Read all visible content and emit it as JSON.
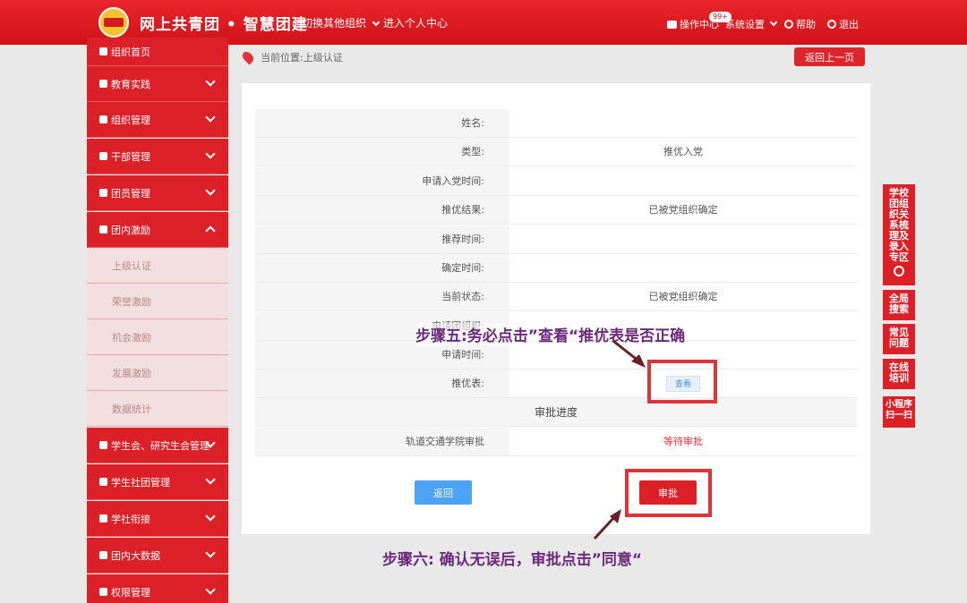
{
  "header": {
    "brand": "网上共青团 • 智慧团建",
    "switch_org": "切换其他组织",
    "personal_center": "进入个人中心",
    "ops_center": "操作中心",
    "ops_badge": "99+",
    "system_settings": "系统设置",
    "help": "帮助",
    "logout": "退出"
  },
  "sidebar": {
    "items": [
      {
        "label": "组织首页"
      },
      {
        "label": "教育实践"
      },
      {
        "label": "组织管理"
      },
      {
        "label": "干部管理"
      },
      {
        "label": "团员管理"
      },
      {
        "label": "团内激励"
      }
    ],
    "sub_items": [
      {
        "label": "上级认证"
      },
      {
        "label": "荣誉激励"
      },
      {
        "label": "机会激励"
      },
      {
        "label": "发展激励"
      },
      {
        "label": "数据统计"
      }
    ],
    "items_after": [
      {
        "label": "学生会、研究生会管理"
      },
      {
        "label": "学生社团管理"
      },
      {
        "label": "学社衔接"
      },
      {
        "label": "团内大数据"
      },
      {
        "label": "权限管理"
      }
    ]
  },
  "main": {
    "breadcrumb": "当前位置:上级认证",
    "back_top": "返回上一页",
    "rows": [
      {
        "label": "姓名:",
        "value": ""
      },
      {
        "label": "类型:",
        "value": "推优入党"
      },
      {
        "label": "申请入党时间:",
        "value": ""
      },
      {
        "label": "推优结果:",
        "value": "已被党组织确定"
      },
      {
        "label": "推荐时间:",
        "value": ""
      },
      {
        "label": "确定时间:",
        "value": ""
      },
      {
        "label": "当前状态:",
        "value": "已被党组织确定"
      },
      {
        "label": "申请团组织:",
        "value": ""
      },
      {
        "label": "申请时间:",
        "value": ""
      },
      {
        "label": "推优表:",
        "value": ""
      }
    ],
    "view_button": "查看",
    "section_title": "审批进度",
    "approval_row": {
      "label": "轨道交通学院审批",
      "value": "等待审批"
    },
    "btn_back": "返回",
    "btn_approve": "审批"
  },
  "annotations": {
    "step5": "步骤五:务必点击”查看“推优表是否正确",
    "step6": "步骤六: 确认无误后，审批点击”同意“"
  },
  "right_tabs": {
    "tab1": "学校团组织关系梳理及录入专区",
    "tab2": "全局搜索",
    "tab3": "常见问题",
    "tab4": "在线培训",
    "tab5": "小程序扫一扫"
  }
}
